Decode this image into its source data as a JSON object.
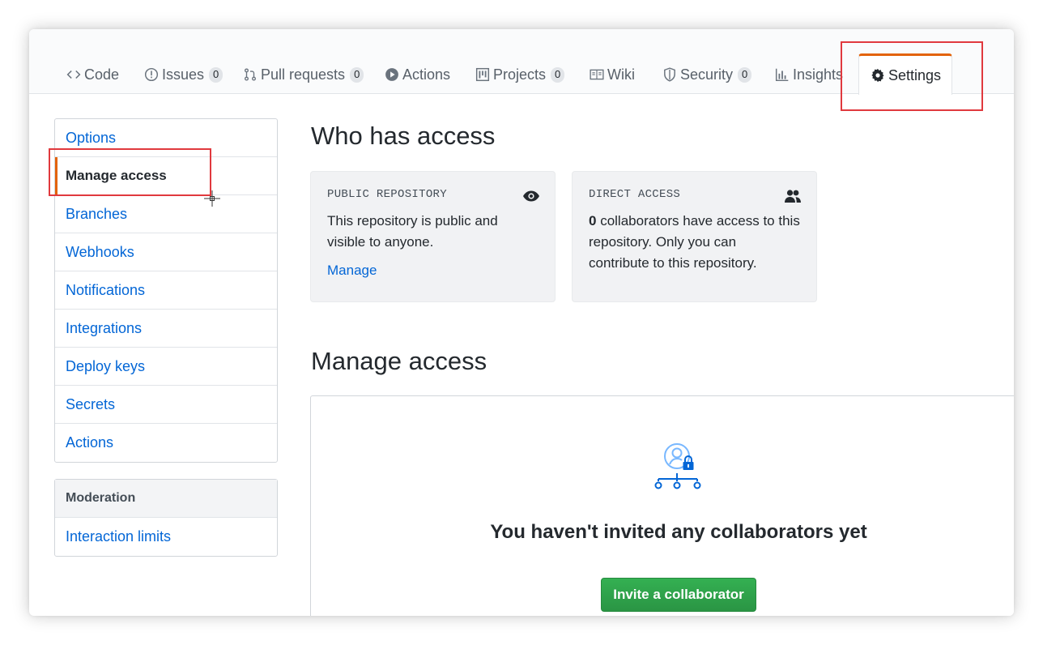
{
  "tabs": [
    {
      "label": "Code",
      "icon": "code-icon"
    },
    {
      "label": "Issues",
      "icon": "issue-opened-icon",
      "count": "0"
    },
    {
      "label": "Pull requests",
      "icon": "git-pull-request-icon",
      "count": "0"
    },
    {
      "label": "Actions",
      "icon": "play-icon"
    },
    {
      "label": "Projects",
      "icon": "project-icon",
      "count": "0"
    },
    {
      "label": "Wiki",
      "icon": "book-icon"
    },
    {
      "label": "Security",
      "icon": "shield-icon",
      "count": "0"
    },
    {
      "label": "Insights",
      "icon": "graph-icon"
    },
    {
      "label": "Settings",
      "icon": "gear-icon",
      "selected": true
    }
  ],
  "sidebar": {
    "items": [
      {
        "label": "Options"
      },
      {
        "label": "Manage access",
        "active": true
      },
      {
        "label": "Branches"
      },
      {
        "label": "Webhooks"
      },
      {
        "label": "Notifications"
      },
      {
        "label": "Integrations"
      },
      {
        "label": "Deploy keys"
      },
      {
        "label": "Secrets"
      },
      {
        "label": "Actions"
      }
    ],
    "moderation": {
      "heading": "Moderation",
      "items": [
        {
          "label": "Interaction limits"
        }
      ]
    }
  },
  "who_has_access": {
    "title": "Who has access",
    "public_card": {
      "label": "PUBLIC REPOSITORY",
      "text": "This repository is public and visible to anyone.",
      "link": "Manage",
      "icon": "eye-icon"
    },
    "direct_card": {
      "label": "DIRECT ACCESS",
      "count": "0",
      "text": " collaborators have access to this repository. Only you can contribute to this repository.",
      "icon": "people-icon"
    }
  },
  "manage_access": {
    "title": "Manage access",
    "blankslate_title": "You haven't invited any collaborators yet",
    "invite_button": "Invite a collaborator",
    "icon": "person-lock-org-icon"
  },
  "colors": {
    "accent": "#e36209",
    "link": "#0366d6",
    "primary_button": "#2ea44f",
    "annotation": "#e0393e"
  }
}
